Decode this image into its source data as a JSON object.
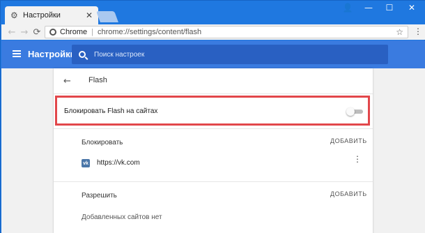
{
  "browser": {
    "tab_title": "Настройки",
    "tab_close": "✕",
    "window_controls": {
      "user": "👤",
      "minimize": "—",
      "maximize": "☐",
      "close": "✕"
    },
    "nav": {
      "back": "←",
      "forward": "→",
      "reload": "⟳"
    },
    "omnibox": {
      "scheme_label": "Chrome",
      "separator": "|",
      "url": "chrome://settings/content/flash",
      "bookmark_icon": "☆"
    },
    "menu_icon": "⋮"
  },
  "settings_header": {
    "title": "Настройки",
    "search_placeholder": "Поиск настроек"
  },
  "flash_page": {
    "back_icon": "←",
    "title": "Flash",
    "block_toggle": {
      "label": "Блокировать Flash на сайтах",
      "enabled": false
    },
    "block_section": {
      "label": "Блокировать",
      "add_label": "ДОБАВИТЬ",
      "sites": [
        {
          "icon": "vk",
          "url": "https://vk.com",
          "menu_icon": "⋮"
        }
      ]
    },
    "allow_section": {
      "label": "Разрешить",
      "add_label": "ДОБАВИТЬ",
      "empty_text": "Добавленных сайтов нет"
    }
  },
  "colors": {
    "titlebar": "#1f78e0",
    "header": "#3a7be0",
    "search_bg": "#2960c2",
    "highlight_border": "#e2474b",
    "vk_brand": "#4a76a8"
  }
}
